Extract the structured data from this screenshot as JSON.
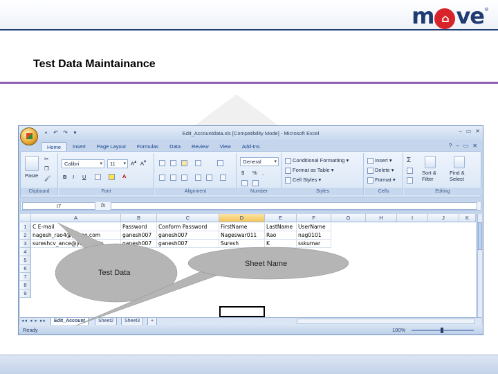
{
  "slide": {
    "logo": {
      "pre": "m",
      "o_glyph": "⌂",
      "post": "ve",
      "mark": "®"
    },
    "title": "Test Data Maintainance"
  },
  "excel": {
    "window_title": "Edit_Accountdata.xls [Compatibility Mode] - Microsoft Excel",
    "window_controls": {
      "minimize": "–",
      "restore": "▭",
      "close": "✕"
    },
    "ribbon_tabs": [
      "Home",
      "Insert",
      "Page Layout",
      "Formulas",
      "Data",
      "Review",
      "View",
      "Add-Ins"
    ],
    "ribbon": {
      "clipboard": {
        "label": "Clipboard",
        "paste": "Paste"
      },
      "font": {
        "label": "Font",
        "font_name": "Calibri",
        "font_size": "11",
        "bold": "B",
        "italic": "I",
        "underline": "U"
      },
      "alignment": {
        "label": "Alignment"
      },
      "number": {
        "label": "Number",
        "format": "General",
        "currency": "$",
        "percent": "%",
        "comma": ","
      },
      "styles": {
        "label": "Styles",
        "conditional": "Conditional Formatting",
        "format_table": "Format as Table",
        "cell_styles": "Cell Styles"
      },
      "cells": {
        "label": "Cells",
        "insert": "Insert",
        "delete": "Delete",
        "format": "Format"
      },
      "editing": {
        "label": "Editing",
        "sigma": "Σ",
        "sort": "Sort & Filter",
        "find": "Find & Select"
      }
    },
    "formula_bar": {
      "name_box": "I7",
      "fx": "fx",
      "value": ""
    },
    "columns": [
      "A",
      "B",
      "C",
      "D",
      "E",
      "F",
      "G",
      "H",
      "I",
      "J",
      "K"
    ],
    "rows": [
      "1",
      "2",
      "3",
      "4",
      "5",
      "6",
      "7",
      "8",
      "9"
    ],
    "cells": {
      "r1": [
        "C E-mail",
        "Password",
        "Conform Password",
        "FirstName",
        "LastName",
        "UserName"
      ],
      "r2": [
        "nagesh_rao4@yahoo.com",
        "ganesh007",
        "ganesh007",
        "Nageswar011",
        "Rao",
        "nag0101"
      ],
      "r3": [
        "sureshcv_ance@yaho.co.in",
        "ganesh007",
        "ganesh007",
        "Suresh",
        "K",
        "sskumar"
      ]
    },
    "sheet_nav": "◂◂ ◂ ▸ ▸▸",
    "sheets": [
      "Edit_Account",
      "Sheet2",
      "Sheet3"
    ],
    "status": "Ready",
    "zoom": "100%"
  },
  "callouts": {
    "test_data": "Test Data",
    "sheet_name": "Sheet Name"
  },
  "colors": {
    "brand_navy": "#1f3b73",
    "brand_red": "#d8232a",
    "title_rule": "#8e5fb0",
    "callout_fill": "#b5b5b5"
  }
}
